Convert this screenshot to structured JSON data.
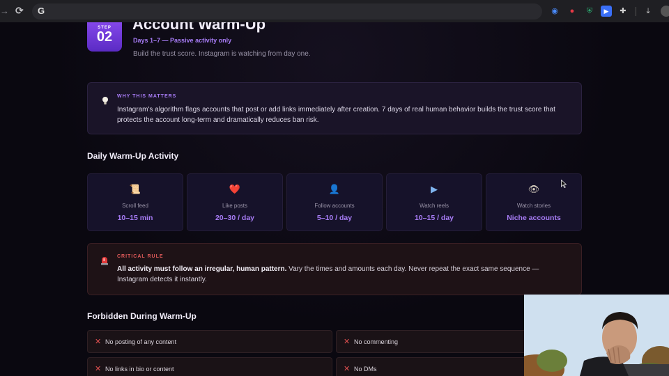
{
  "browser": {
    "google_glyph": "G",
    "icons": [
      "back-arrow-icon",
      "reload-icon",
      "radio-waves-icon",
      "ladybug-icon",
      "shield-icon",
      "play-square-icon",
      "puzzle-icon",
      "download-icon"
    ]
  },
  "header": {
    "step_label": "STEP",
    "step_number": "02",
    "title": "Account Warm-Up",
    "subtitle": "Days 1–7 — Passive activity only",
    "description": "Build the trust score. Instagram is watching from day one."
  },
  "why": {
    "label": "WHY THIS MATTERS",
    "text": "Instagram's algorithm flags accounts that post or add links immediately after creation. 7 days of real human behavior builds the trust score that protects the account long-term and dramatically reduces ban risk."
  },
  "activity": {
    "title": "Daily Warm-Up Activity",
    "items": [
      {
        "icon": "📜",
        "label": "Scroll feed",
        "value": "10–15 min"
      },
      {
        "icon": "❤️",
        "label": "Like posts",
        "value": "20–30 / day"
      },
      {
        "icon": "👤",
        "label": "Follow accounts",
        "value": "5–10 / day"
      },
      {
        "icon": "▶",
        "label": "Watch reels",
        "value": "10–15 / day"
      },
      {
        "icon": "👁",
        "label": "Watch stories",
        "value": "Niche accounts"
      }
    ]
  },
  "rule": {
    "label": "CRITICAL RULE",
    "strong": "All activity must follow an irregular, human pattern.",
    "text": " Vary the times and amounts each day. Never repeat the exact same sequence — Instagram detects it instantly."
  },
  "forbidden": {
    "title": "Forbidden During Warm-Up",
    "items": [
      {
        "label": "No posting of any content"
      },
      {
        "label": "No commenting"
      },
      {
        "label": "No links in bio or content"
      },
      {
        "label": "No DMs"
      }
    ],
    "x_glyph": "✕"
  },
  "colors": {
    "accent": "#a77cf5",
    "danger": "#e05a5a",
    "background": "#0a0810"
  }
}
